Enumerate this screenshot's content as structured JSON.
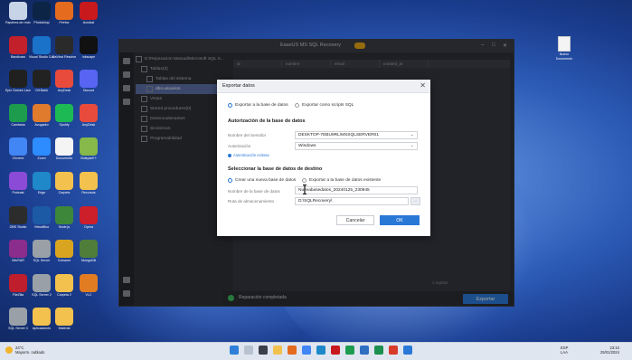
{
  "app": {
    "title": "EaseUS MS SQL Recovery",
    "tree": {
      "root": "D:\\Reparacion Manual\\Microsoft SQL S...",
      "tables_folder": "Tablas(3)",
      "items": [
        "Tablas del sistema",
        "dbo.usuarios"
      ],
      "others": [
        "Vistas",
        "Stored procedures(0)",
        "Desencadenantes",
        "Sinónimos",
        "Programabilidad"
      ]
    },
    "grid_headers": [
      "id",
      "nombre",
      "email",
      "created_at"
    ],
    "pager": "1 registro",
    "status": "Reparación completada",
    "export_button": "Exportar"
  },
  "modal": {
    "title": "Exportar datos",
    "close": "✕",
    "export_options": [
      "Exportar a la base de datos",
      "Exportar como scripts SQL"
    ],
    "section_auth": "Autorización de la base de datos",
    "server_label": "Nombre del Servidor",
    "server_value": "DESKTOP-7EBU9RL\\MSSQLSERVER01",
    "auth_label": "Autorización",
    "auth_value": "Windows",
    "auth_link": "Autenticación exitosa",
    "section_target": "Seleccionar la base de datos de destino",
    "target_options": [
      "Crear una nueva base de datos",
      "Exportar a la base de datos existente"
    ],
    "dbname_label": "Nombre de la base de datos",
    "dbname_value": "Nuevabasedatos_20240125_230945",
    "path_label": "Ruta de almacenamiento",
    "path_value": "D:\\SQLRecovery\\",
    "cancel": "Cancelar",
    "ok": "OK"
  },
  "desktop": {
    "file_label": "Nuevo Documento",
    "icons": [
      {
        "label": "Papelera de reciclaje",
        "color": "#c7d3e6"
      },
      {
        "label": "Photoshop",
        "color": "#0c2446"
      },
      {
        "label": "Firefox",
        "color": "#e56b1f"
      },
      {
        "label": "Acrobat",
        "color": "#c8191d"
      },
      {
        "label": "Bandicam",
        "color": "#c2202b"
      },
      {
        "label": "Visual Studio Code",
        "color": "#1a73c9"
      },
      {
        "label": "DaVinci Resolve",
        "color": "#2a2a2a"
      },
      {
        "label": "Inkscape",
        "color": "#111"
      },
      {
        "label": "Epic Games Launcher",
        "color": "#202020"
      },
      {
        "label": "Git Bash",
        "color": "#222"
      },
      {
        "label": "AnyDesk",
        "color": "#e84b3c"
      },
      {
        "label": "Discord",
        "color": "#5865f2"
      },
      {
        "label": "Camtasia",
        "color": "#1c9c4c"
      },
      {
        "label": "Avogadro",
        "color": "#e07a2c"
      },
      {
        "label": "Spotify",
        "color": "#1db954"
      },
      {
        "label": "AnyDesk",
        "color": "#e84b3c"
      },
      {
        "label": "Chrome",
        "color": "#4285f4"
      },
      {
        "label": "Zoom",
        "color": "#2d8cff"
      },
      {
        "label": "Documento",
        "color": "#f4f4f4"
      },
      {
        "label": "Notepad++",
        "color": "#86b84a"
      },
      {
        "label": "Podcast",
        "color": "#8c4bd6"
      },
      {
        "label": "Edge",
        "color": "#1e88c8"
      },
      {
        "label": "Carpeta",
        "color": "#f2c14e"
      },
      {
        "label": "Recursos",
        "color": "#f2c14e"
      },
      {
        "label": "OBS Studio",
        "color": "#2c2c2c"
      },
      {
        "label": "VirtualBox",
        "color": "#1d5aa6"
      },
      {
        "label": "Node.js",
        "color": "#3c873a"
      },
      {
        "label": "Opera",
        "color": "#cc1e2b"
      },
      {
        "label": "WinRAR",
        "color": "#8b2d8c"
      },
      {
        "label": "SQL Server",
        "color": "#9aa0a8"
      },
      {
        "label": "Ccleaner",
        "color": "#d9a420"
      },
      {
        "label": "MongoDB",
        "color": "#4f7d3a"
      },
      {
        "label": "FileZilla",
        "color": "#bf1e2d"
      },
      {
        "label": "SQL Server 2",
        "color": "#9aa0a8"
      },
      {
        "label": "Carpeta 2",
        "color": "#f2c14e"
      },
      {
        "label": "VLC",
        "color": "#e27c22"
      },
      {
        "label": "SQL Server 3",
        "color": "#9aa0a8"
      },
      {
        "label": "Aplicaciones",
        "color": "#f2c14e"
      },
      {
        "label": "Material",
        "color": "#f2c14e"
      }
    ]
  },
  "taskbar": {
    "temp": "24°C",
    "weather": "Mayorm. nublado",
    "lang": "ESP",
    "lang2": "LAA",
    "time": "23:10",
    "date": "25/01/2024"
  }
}
